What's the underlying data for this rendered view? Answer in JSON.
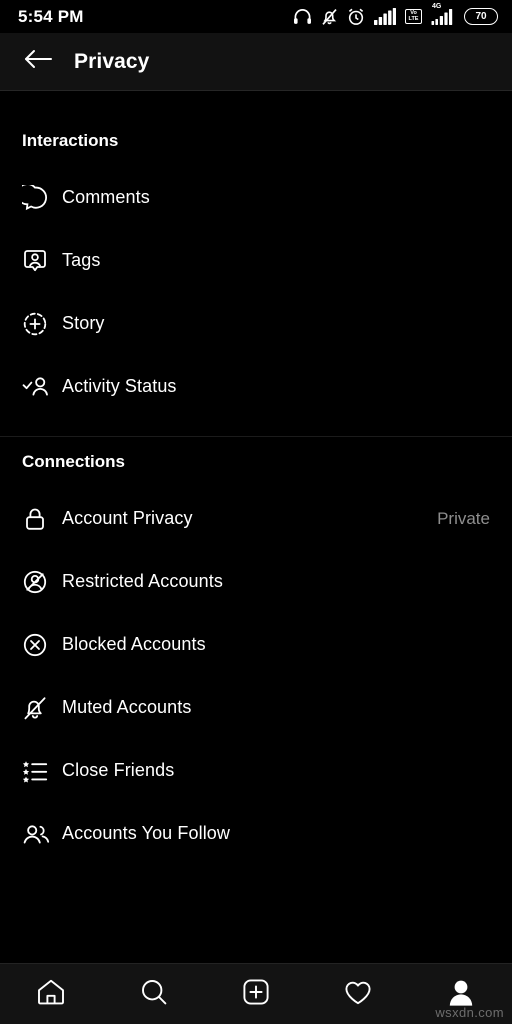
{
  "statusbar": {
    "time": "5:54 PM",
    "icons": [
      "headphones-icon",
      "bell-muted-icon",
      "alarm-clock-icon",
      "signal-bars-icon",
      "volte-icon",
      "signal-4g-icon"
    ],
    "volte_top": "Vo",
    "volte_bottom": "LTE",
    "network_label": "4G",
    "battery_level": "70"
  },
  "header": {
    "back_icon": "back-arrow-icon",
    "title": "Privacy"
  },
  "sections": [
    {
      "title": "Interactions",
      "rows": [
        {
          "label": "Comments",
          "icon": "comment-bubble-icon",
          "value": ""
        },
        {
          "label": "Tags",
          "icon": "tag-person-icon",
          "value": ""
        },
        {
          "label": "Story",
          "icon": "story-plus-icon",
          "value": ""
        },
        {
          "label": "Activity Status",
          "icon": "activity-status-icon",
          "value": ""
        }
      ]
    },
    {
      "title": "Connections",
      "rows": [
        {
          "label": "Account Privacy",
          "icon": "lock-icon",
          "value": "Private"
        },
        {
          "label": "Restricted Accounts",
          "icon": "restricted-person-icon",
          "value": ""
        },
        {
          "label": "Blocked Accounts",
          "icon": "blocked-circle-x-icon",
          "value": ""
        },
        {
          "label": "Muted Accounts",
          "icon": "bell-slash-icon",
          "value": ""
        },
        {
          "label": "Close Friends",
          "icon": "star-list-icon",
          "value": ""
        },
        {
          "label": "Accounts You Follow",
          "icon": "people-icon",
          "value": ""
        }
      ]
    }
  ],
  "navbar": {
    "items": [
      {
        "name": "home-icon"
      },
      {
        "name": "search-icon"
      },
      {
        "name": "add-post-icon"
      },
      {
        "name": "heart-icon"
      },
      {
        "name": "profile-avatar-icon"
      }
    ]
  },
  "watermark": "wsxdn.com",
  "colors": {
    "background": "#000000",
    "header_background": "#121212",
    "text_primary": "#ffffff",
    "text_secondary": "#8e8e8e",
    "divider": "#1b1b1b"
  }
}
